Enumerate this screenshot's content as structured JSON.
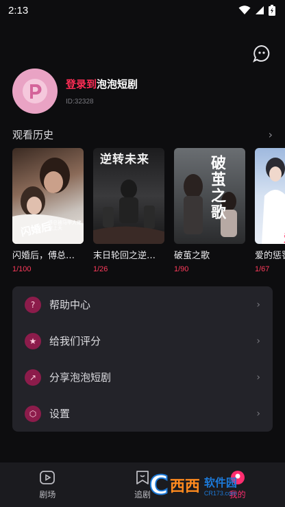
{
  "status": {
    "time": "2:13"
  },
  "profile": {
    "login_prefix": "登录到",
    "app_name": "泡泡短剧",
    "user_id": "ID:32328"
  },
  "history": {
    "title": "观看历史",
    "items": [
      {
        "title": "闪婚后，傅总被马甲大佬宠上天了",
        "progress": "1/100",
        "poster_text": "闪婚后",
        "poster_sub": "傅总被马甲大佬宠上天"
      },
      {
        "title": "末日轮回之逆转未来",
        "progress": "1/26",
        "poster_text": "逆转未来",
        "poster_sub": ""
      },
      {
        "title": "破茧之歌",
        "progress": "1/90",
        "poster_text": "破茧之歌",
        "poster_sub": ""
      },
      {
        "title": "爱的惩罚",
        "progress": "1/67",
        "poster_text": "爱的",
        "poster_sub": ""
      }
    ]
  },
  "menu": [
    {
      "label": "帮助中心",
      "icon": "help-icon"
    },
    {
      "label": "给我们评分",
      "icon": "star-bag-icon"
    },
    {
      "label": "分享泡泡短剧",
      "icon": "share-icon"
    },
    {
      "label": "设置",
      "icon": "settings-icon"
    }
  ],
  "tabs": [
    {
      "label": "剧场",
      "icon": "theater-icon"
    },
    {
      "label": "追剧",
      "icon": "bookmark-icon"
    },
    {
      "label": "我的",
      "icon": "profile-icon"
    }
  ],
  "watermark": {
    "name": "软件园",
    "brand": "西西",
    "url": "CR173.com"
  },
  "colors": {
    "accent": "#ff2d55",
    "menu_bg": "#232329",
    "background": "#0d0d0f"
  }
}
